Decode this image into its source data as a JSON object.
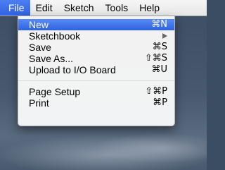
{
  "menubar": {
    "items": [
      {
        "label": "File",
        "active": true
      },
      {
        "label": "Edit"
      },
      {
        "label": "Sketch"
      },
      {
        "label": "Tools"
      },
      {
        "label": "Help"
      }
    ]
  },
  "file_menu": {
    "group1": [
      {
        "label": "New",
        "shortcut": "⌘N",
        "highlighted": true
      },
      {
        "label": "Sketchbook",
        "submenu": true
      },
      {
        "label": "Save",
        "shortcut": "⌘S"
      },
      {
        "label": "Save As...",
        "shortcut": "⇧⌘S"
      },
      {
        "label": "Upload to I/O Board",
        "shortcut": "⌘U"
      }
    ],
    "group2": [
      {
        "label": "Page Setup",
        "shortcut": "⇧⌘P"
      },
      {
        "label": "Print",
        "shortcut": "⌘P"
      }
    ]
  },
  "colors": {
    "highlight": "#2f63e0",
    "menubar_bg": "#eeeeee",
    "desktop_bg": "#48596f"
  }
}
